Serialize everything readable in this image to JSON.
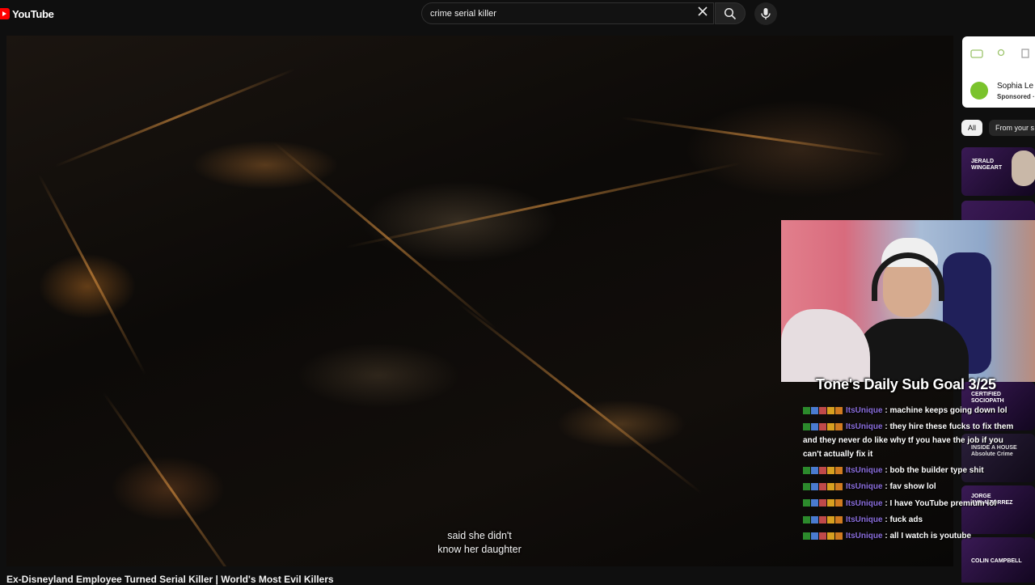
{
  "header": {
    "logo_text": "YouTube",
    "search_value": "crime serial killer",
    "clear_icon": "close-icon",
    "search_icon": "search-icon",
    "mic_icon": "mic-icon"
  },
  "video": {
    "subtitle": "said she didn't\nknow her daughter",
    "title": "Ex-Disneyland Employee Turned Serial Killer | World's Most Evil Killers"
  },
  "sidebar": {
    "ad": {
      "name": "Sophia Le",
      "sponsored": "Sponsored ·"
    },
    "chips": [
      "All",
      "From your s"
    ],
    "thumbs": [
      {
        "label": "JERALD\nWINGEART"
      },
      {
        "label": "CERTIFIED\nSOCIOPATH"
      },
      {
        "label": "INSIDE A HOUSE\nAbsolute Crime"
      },
      {
        "label": "JORGE\nAVILA-TORREZ"
      },
      {
        "label": "COLIN CAMPBELL"
      }
    ]
  },
  "stream": {
    "goal": "Tone's Daily Sub Goal 3/25",
    "chat": [
      {
        "user": "ItsUnique",
        "text": "machine keeps going down lol"
      },
      {
        "user": "ItsUnique",
        "text": "they hire these fucks to fix them and they never do like why tf you have the job if you can't actually fix it"
      },
      {
        "user": "ItsUnique",
        "text": "bob the builder type shit"
      },
      {
        "user": "ItsUnique",
        "text": "fav show lol"
      },
      {
        "user": "ItsUnique",
        "text": "I have YouTube premium lol"
      },
      {
        "user": "ItsUnique",
        "text": "fuck ads"
      },
      {
        "user": "ItsUnique",
        "text": "all I watch is youtube"
      }
    ]
  },
  "colors": {
    "brand_red": "#ff0000",
    "chat_user": "#8a6ddc",
    "background": "#0f0f0f"
  }
}
